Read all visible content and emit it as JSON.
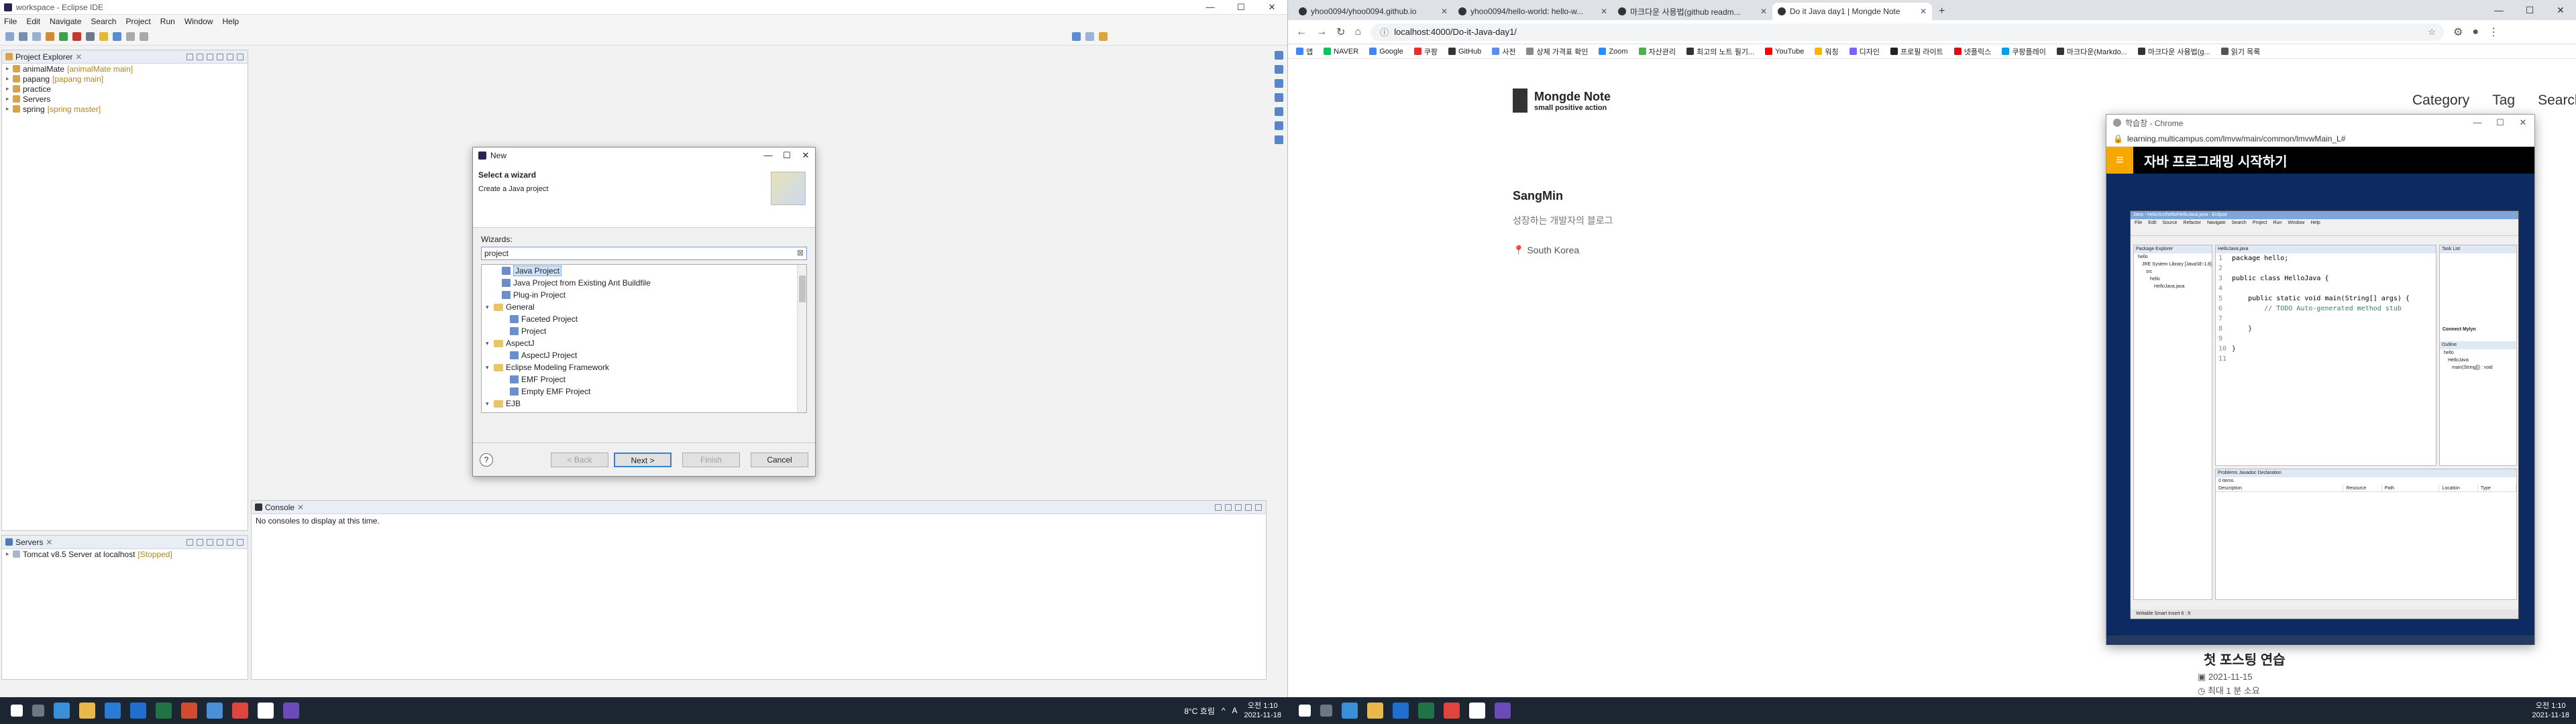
{
  "eclipse": {
    "window_title": "workspace - Eclipse IDE",
    "menu": [
      "File",
      "Edit",
      "Navigate",
      "Search",
      "Project",
      "Run",
      "Window",
      "Help"
    ],
    "project_explorer": {
      "title": "Project Explorer",
      "items": [
        {
          "name": "animalMate",
          "tag": "[animalMate main]"
        },
        {
          "name": "papang",
          "tag": "[papang main]"
        },
        {
          "name": "practice",
          "tag": ""
        },
        {
          "name": "Servers",
          "tag": ""
        },
        {
          "name": "spring",
          "tag": "[spring master]"
        }
      ]
    },
    "servers": {
      "title": "Servers",
      "item": "Tomcat v8.5 Server at localhost",
      "state": "[Stopped]"
    },
    "console": {
      "title": "Console",
      "message": "No consoles to display at this time."
    },
    "dialog": {
      "title": "New",
      "heading": "Select a wizard",
      "subheading": "Create a Java project",
      "wizards_label": "Wizards:",
      "filter_value": "project",
      "list": [
        {
          "label": "Java Project",
          "type": "project",
          "indent": 1,
          "selected": true,
          "twisty": ""
        },
        {
          "label": "Java Project from Existing Ant Buildfile",
          "type": "project",
          "indent": 1,
          "twisty": ""
        },
        {
          "label": "Plug-in Project",
          "type": "project",
          "indent": 1,
          "twisty": ""
        },
        {
          "label": "General",
          "type": "folder",
          "indent": 0,
          "twisty": "▾"
        },
        {
          "label": "Faceted Project",
          "type": "project",
          "indent": 2,
          "twisty": ""
        },
        {
          "label": "Project",
          "type": "project",
          "indent": 2,
          "twisty": ""
        },
        {
          "label": "AspectJ",
          "type": "folder",
          "indent": 0,
          "twisty": "▾"
        },
        {
          "label": "AspectJ Project",
          "type": "project",
          "indent": 2,
          "twisty": ""
        },
        {
          "label": "Eclipse Modeling Framework",
          "type": "folder",
          "indent": 0,
          "twisty": "▾"
        },
        {
          "label": "EMF Project",
          "type": "project",
          "indent": 2,
          "twisty": ""
        },
        {
          "label": "Empty EMF Project",
          "type": "project",
          "indent": 2,
          "twisty": ""
        },
        {
          "label": "EJB",
          "type": "folder",
          "indent": 0,
          "twisty": "▾"
        }
      ],
      "buttons": {
        "back": "< Back",
        "next": "Next >",
        "finish": "Finish",
        "cancel": "Cancel"
      }
    }
  },
  "taskbar_left": {
    "time": "오전 1:10",
    "date": "2021-11-18",
    "weather": "8°C 흐림",
    "lang": "A"
  },
  "taskbar_right": {
    "time": "오전 1:10",
    "date": "2021-11-18"
  },
  "chrome": {
    "tabs": [
      {
        "label": "yhoo0094/yhoo0094.github.io",
        "active": false
      },
      {
        "label": "yhoo0094/hello-world: hello-w...",
        "active": false
      },
      {
        "label": "마크다운 사용법(github readm...",
        "active": false
      },
      {
        "label": "Do it Java day1 | Mongde Note",
        "active": true
      }
    ],
    "url": "localhost:4000/Do-it-Java-day1/",
    "bookmarks": [
      "앱",
      "NAVER",
      "Google",
      "쿠팡",
      "GitHub",
      "사전",
      "상체 가격표 확인",
      "Zoom",
      "자산관리",
      "최고의 노트 필기...",
      "YouTube",
      "워칭",
      "디자인",
      "프로필 라이트",
      "넷플릭스",
      "쿠팡플레이",
      "마크다운(Markdo...",
      "마크다운 사용법(g...",
      "읽기 목록"
    ],
    "blog": {
      "logo_title": "Mongde Note",
      "logo_sub": "small positive action",
      "nav": [
        "Category",
        "Tag",
        "Search"
      ],
      "author": "SangMin",
      "bio": "성장하는 개발자의 블로그",
      "location": "South Korea",
      "post_title": "첫 포스팅 연습",
      "post_date": "2021-11-15",
      "post_read": "최대 1 분 소요"
    },
    "popup": {
      "window_title": "학습창 - Chrome",
      "url": "learning.multicampus.com/lmvw/main/common/lmvwMain_L#",
      "header": "자바 프로그래밍 시작하기",
      "video": {
        "title": "Java - hello/src/hello/HelloJava.java - Eclipse",
        "menu": [
          "File",
          "Edit",
          "Source",
          "Refactor",
          "Navigate",
          "Search",
          "Project",
          "Run",
          "Window",
          "Help"
        ],
        "explorer_title": "Package Explorer",
        "explorer_items": [
          "hello",
          "JRE System Library [JavaSE-1.8]",
          "src",
          "hello",
          "HelloJava.java"
        ],
        "editor_tab": "HelloJava.java",
        "code": [
          {
            "n": "1",
            "t": "package hello;",
            "k": "kw1"
          },
          {
            "n": "2",
            "t": "",
            "k": ""
          },
          {
            "n": "3",
            "t": "public class HelloJava {",
            "k": "kw2"
          },
          {
            "n": "4",
            "t": "",
            "k": ""
          },
          {
            "n": "5",
            "t": "    public static void main(String[] args) {",
            "k": "kw3"
          },
          {
            "n": "6",
            "t": "        // TODO Auto-generated method stub",
            "k": "cm"
          },
          {
            "n": "7",
            "t": "",
            "k": ""
          },
          {
            "n": "8",
            "t": "    }",
            "k": ""
          },
          {
            "n": "9",
            "t": "",
            "k": ""
          },
          {
            "n": "10",
            "t": "}",
            "k": ""
          },
          {
            "n": "11",
            "t": "",
            "k": ""
          }
        ],
        "tasks_title": "Task List",
        "outline_title": "Outline",
        "mylyn_title": "Connect Mylyn",
        "outline_items": [
          "hello",
          "HelloJava",
          "main(String[]) : void"
        ],
        "problems_tabs": "Problems  Javadoc  Declaration",
        "problems_items": "0 items",
        "problems_cols": [
          "Description",
          "Resource",
          "Path",
          "Location",
          "Type"
        ],
        "status": "Writable     Smart Insert     6 : 9"
      }
    }
  }
}
